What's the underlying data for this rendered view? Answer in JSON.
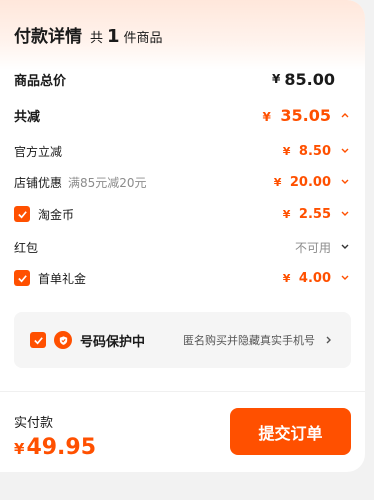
{
  "header": {
    "title": "付款详情",
    "count_prefix": "共",
    "count": "1",
    "count_suffix": "件商品"
  },
  "summary": {
    "total_label": "商品总价",
    "total_currency": "¥",
    "total_value": "85.00",
    "discount_label": "共减",
    "discount_currency": "¥",
    "discount_value": "35.05"
  },
  "items": {
    "official": {
      "label": "官方立减",
      "currency": "¥",
      "value": "8.50"
    },
    "store": {
      "label": "店铺优惠",
      "sub": "满85元减20元",
      "currency": "¥",
      "value": "20.00"
    },
    "taojinbi": {
      "label": "淘金币",
      "currency": "¥",
      "value": "2.55",
      "checked": true
    },
    "redpacket": {
      "label": "红包",
      "status": "不可用"
    },
    "first_order": {
      "label": "首单礼金",
      "currency": "¥",
      "value": "4.00",
      "checked": true
    }
  },
  "protect": {
    "checked": true,
    "title": "号码保护中",
    "desc": "匿名购买并隐藏真实手机号"
  },
  "footer": {
    "pay_label": "实付款",
    "pay_currency": "¥",
    "pay_value": "49.95",
    "submit_label": "提交订单"
  },
  "colors": {
    "accent": "#ff5000",
    "text": "#1a1a1a",
    "muted": "#8c8c8c"
  }
}
